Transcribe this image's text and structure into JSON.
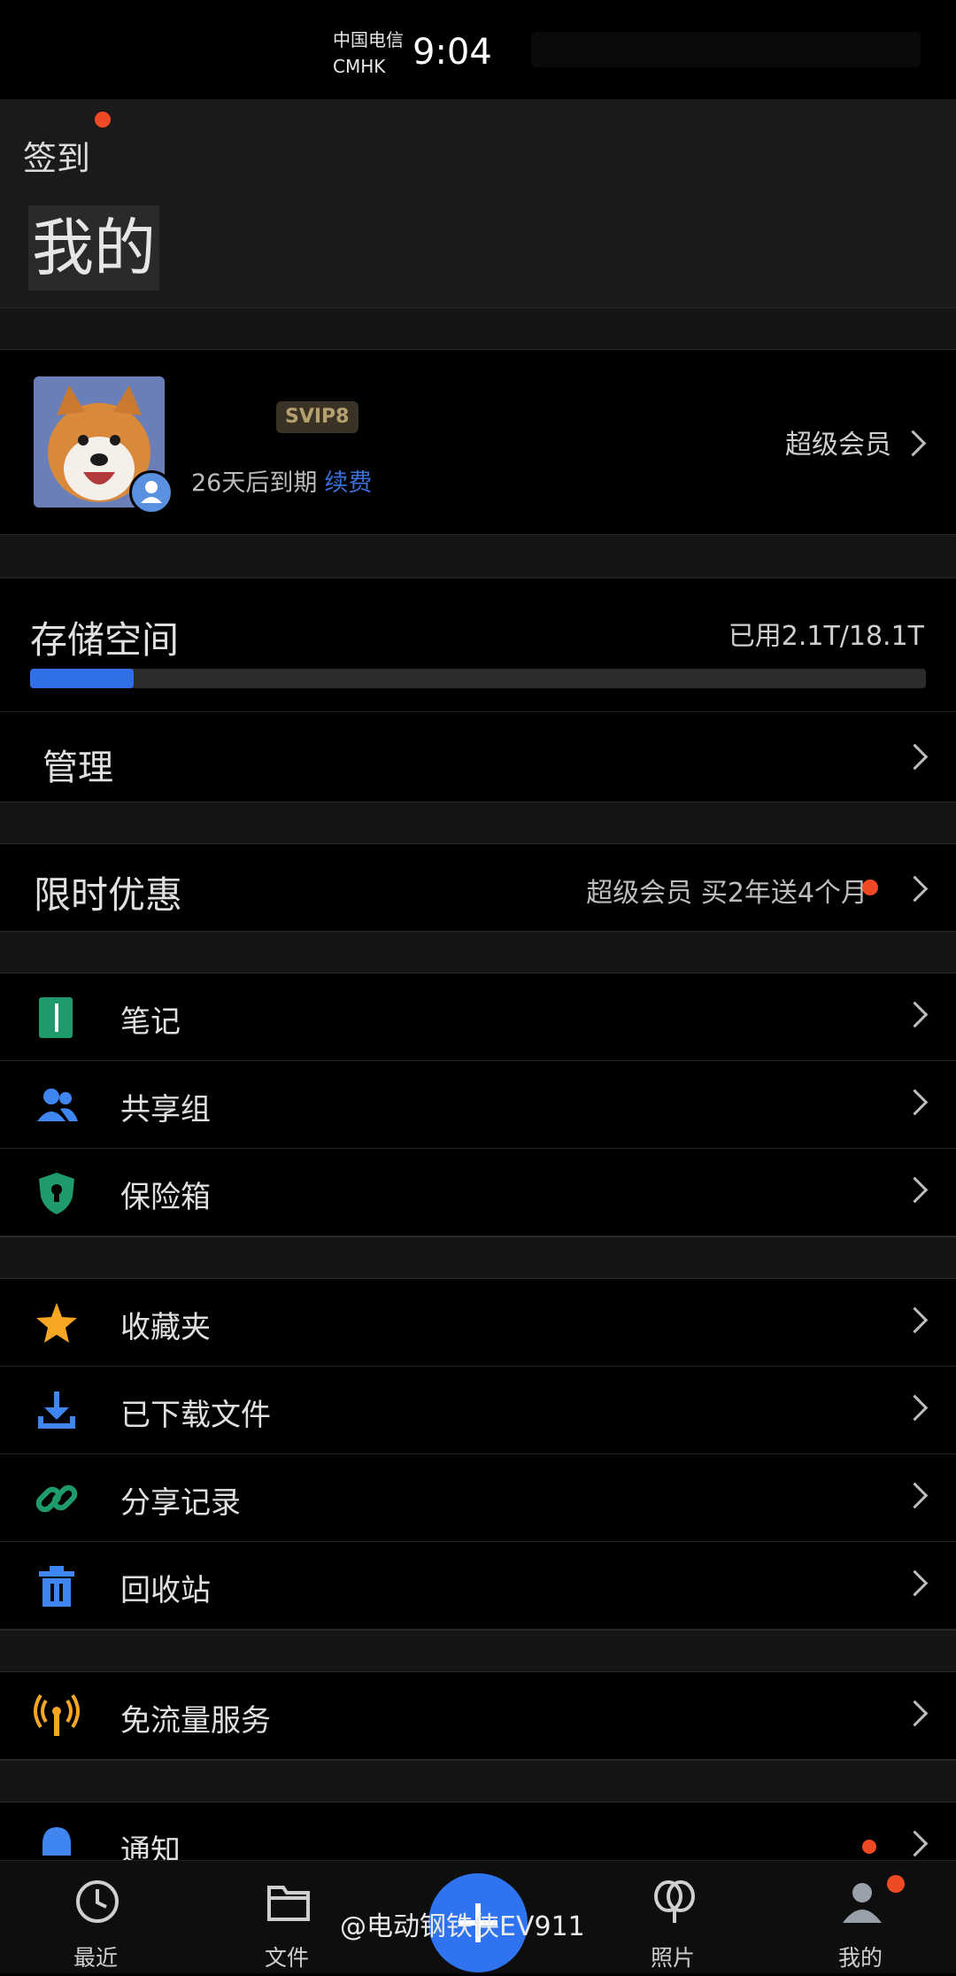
{
  "status_bar": {
    "carrier_line1": "中国电信",
    "carrier_line2": "CMHK",
    "time": "9:04"
  },
  "header": {
    "checkin_label": "签到",
    "title": "我的"
  },
  "profile": {
    "badge": "SVIP8",
    "expiry_text": "26天后到期",
    "renew_label": "续费",
    "vip_link_label": "超级会员"
  },
  "storage": {
    "title": "存储空间",
    "usage_text": "已用2.1T/18.1T",
    "used_fraction": 0.116,
    "manage_label": "管理"
  },
  "promo": {
    "title": "限时优惠",
    "text": "超级会员 买2年送4个月"
  },
  "groups": [
    [
      {
        "label": "笔记",
        "icon": "note-icon",
        "color": "#1f9a6a"
      },
      {
        "label": "共享组",
        "icon": "group-icon",
        "color": "#3f86f0"
      },
      {
        "label": "保险箱",
        "icon": "safe-shield-icon",
        "color": "#1f9a6a"
      }
    ],
    [
      {
        "label": "收藏夹",
        "icon": "star-icon",
        "color": "#f5a623"
      },
      {
        "label": "已下载文件",
        "icon": "download-icon",
        "color": "#3f86f0"
      },
      {
        "label": "分享记录",
        "icon": "link-icon",
        "color": "#1f9a6a"
      },
      {
        "label": "回收站",
        "icon": "trash-icon",
        "color": "#3f86f0"
      }
    ],
    [
      {
        "label": "免流量服务",
        "icon": "antenna-icon",
        "color": "#f5a623"
      }
    ],
    [
      {
        "label": "通知",
        "icon": "bell-icon",
        "color": "#3f86f0"
      }
    ]
  ],
  "bottom_nav": [
    {
      "label": "最近",
      "icon": "clock-icon"
    },
    {
      "label": "文件",
      "icon": "folder-icon"
    },
    {
      "label": "",
      "icon": "plus-icon"
    },
    {
      "label": "照片",
      "icon": "balloon-icon"
    },
    {
      "label": "我的",
      "icon": "person-icon"
    }
  ],
  "watermark": "@电动钢铁侠EV911"
}
